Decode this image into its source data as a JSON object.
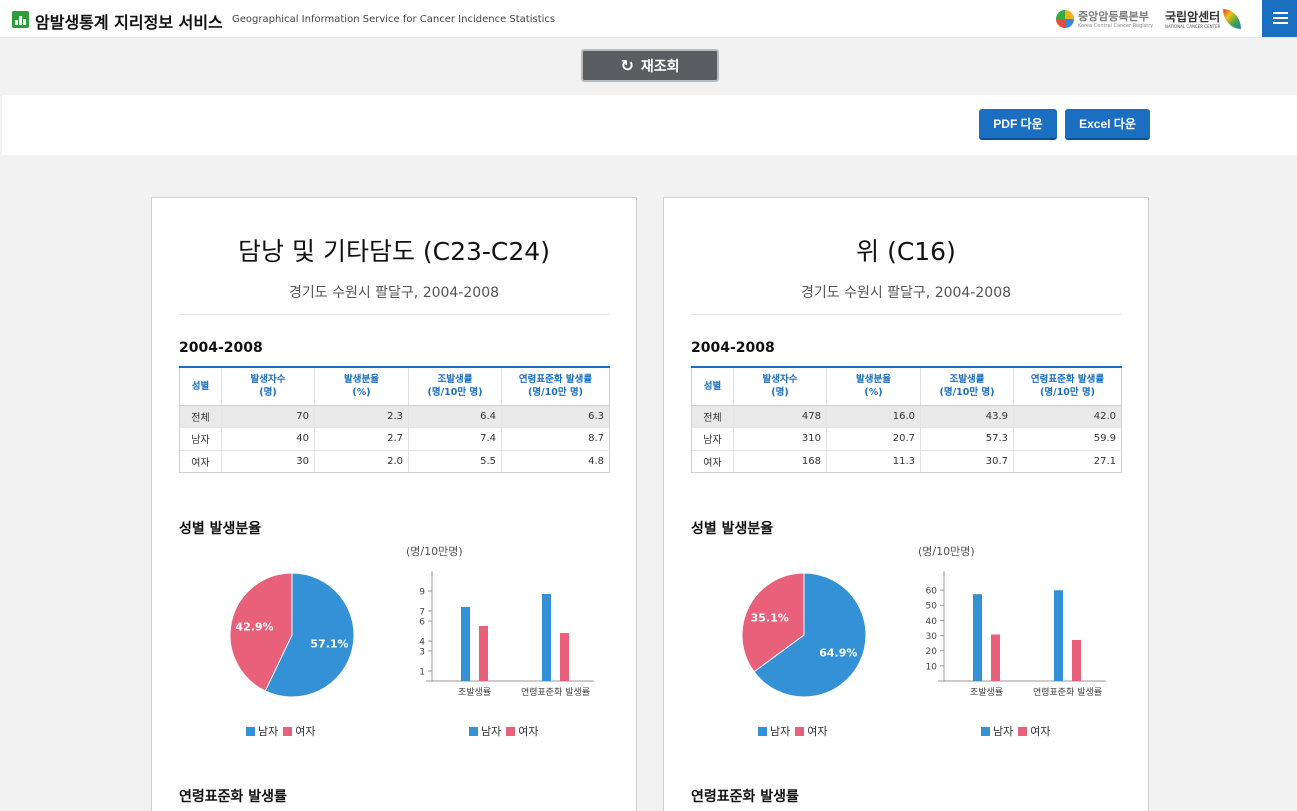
{
  "app": {
    "title": "암발생통계 지리정보 서비스",
    "subtitle": "Geographical Information Service for Cancer Incidence Statistics",
    "partner1_name": "중앙암등록본부",
    "partner1_sub": "Korea Central Cancer Registry",
    "partner2_name": "국립암센터",
    "partner2_sub": "NATIONAL CANCER CENTER"
  },
  "toolbar": {
    "reload_label": "재조회",
    "pdf_label": "PDF 다운",
    "excel_label": "Excel 다운"
  },
  "colors": {
    "male": "#3491d6",
    "female": "#e8607a",
    "accent": "#1a6fc0"
  },
  "table_headers": [
    "성별",
    "발생자수\n(명)",
    "발생분율\n(%)",
    "조발생률\n(명/10만 명)",
    "연령표준화 발생률\n(명/10만 명)"
  ],
  "cards": [
    {
      "title": "담낭 및 기타담도 (C23-C24)",
      "subtitle": "경기도 수원시 팔달구, 2004-2008",
      "table_title": "2004-2008",
      "rows": [
        {
          "sex": "전체",
          "count": "70",
          "share": "2.3",
          "crude": "6.4",
          "asr": "6.3"
        },
        {
          "sex": "남자",
          "count": "40",
          "share": "2.7",
          "crude": "7.4",
          "asr": "8.7"
        },
        {
          "sex": "여자",
          "count": "30",
          "share": "2.0",
          "crude": "5.5",
          "asr": "4.8"
        }
      ],
      "section_share": "성별 발생분율",
      "section_asr": "연령표준화 발생률",
      "unit": "(명/10만명)",
      "legend": {
        "male": "남자",
        "female": "여자"
      },
      "chart_data": [
        {
          "type": "pie",
          "labels": [
            "남자",
            "여자"
          ],
          "values": [
            57.1,
            42.9
          ],
          "display": [
            "57.1%",
            "42.9%"
          ]
        },
        {
          "type": "bar",
          "categories": [
            "조발생률",
            "연령표준화 발생률"
          ],
          "series": [
            {
              "name": "남자",
              "values": [
                7.4,
                8.7
              ]
            },
            {
              "name": "여자",
              "values": [
                5.5,
                4.8
              ]
            }
          ],
          "ylim": [
            0,
            10
          ],
          "yticks": [
            1,
            3,
            4,
            6,
            7,
            9
          ],
          "ylabel": "(명/10만명)"
        }
      ]
    },
    {
      "title": "위 (C16)",
      "subtitle": "경기도 수원시 팔달구, 2004-2008",
      "table_title": "2004-2008",
      "rows": [
        {
          "sex": "전체",
          "count": "478",
          "share": "16.0",
          "crude": "43.9",
          "asr": "42.0"
        },
        {
          "sex": "남자",
          "count": "310",
          "share": "20.7",
          "crude": "57.3",
          "asr": "59.9"
        },
        {
          "sex": "여자",
          "count": "168",
          "share": "11.3",
          "crude": "30.7",
          "asr": "27.1"
        }
      ],
      "section_share": "성별 발생분율",
      "section_asr": "연령표준화 발생률",
      "unit": "(명/10만명)",
      "legend": {
        "male": "남자",
        "female": "여자"
      },
      "chart_data": [
        {
          "type": "pie",
          "labels": [
            "남자",
            "여자"
          ],
          "values": [
            64.9,
            35.1
          ],
          "display": [
            "64.9%",
            "35.1%"
          ]
        },
        {
          "type": "bar",
          "categories": [
            "조발생률",
            "연령표준화 발생률"
          ],
          "series": [
            {
              "name": "남자",
              "values": [
                57.3,
                59.9
              ]
            },
            {
              "name": "여자",
              "values": [
                30.7,
                27.1
              ]
            }
          ],
          "ylim": [
            0,
            66
          ],
          "yticks": [
            10,
            20,
            30,
            40,
            50,
            60
          ],
          "ylabel": "(명/10만명)"
        }
      ]
    }
  ]
}
